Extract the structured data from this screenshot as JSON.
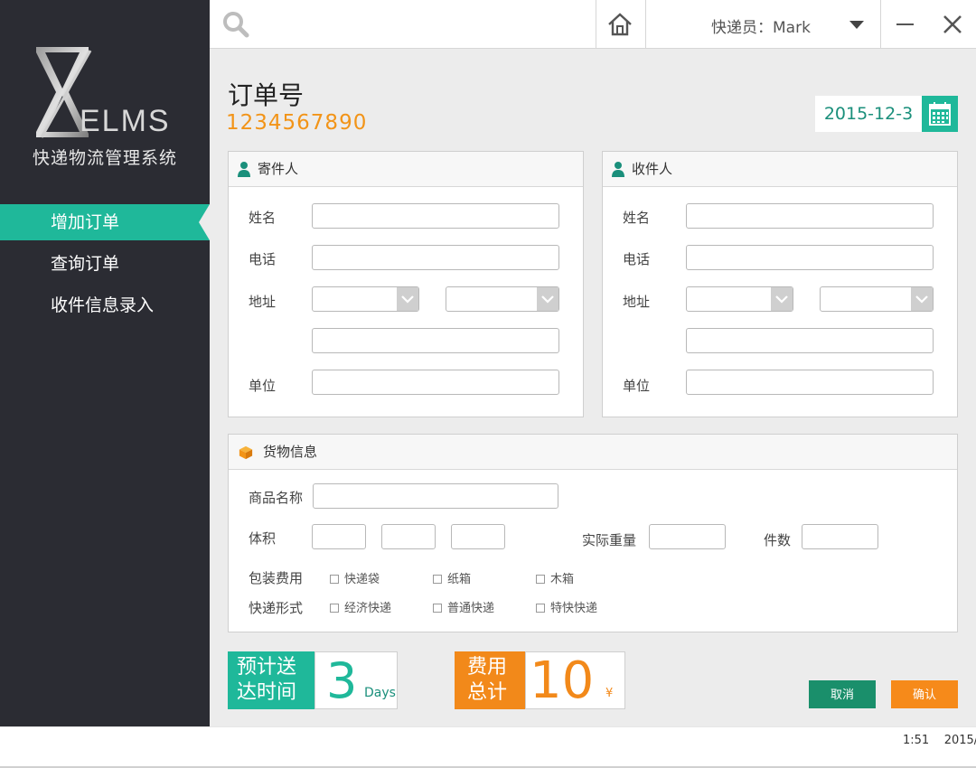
{
  "app": {
    "logo_text": "ELMS",
    "logo_subtitle": "快递物流管理系统"
  },
  "sidebar": {
    "items": [
      {
        "label": "增加订单",
        "active": true
      },
      {
        "label": "查询订单",
        "active": false
      },
      {
        "label": "收件信息录入",
        "active": false
      }
    ]
  },
  "topbar": {
    "courier_label": "快递员：Mark",
    "icons": [
      "search-icon",
      "home-icon",
      "chevron-down-icon",
      "minimize-icon",
      "close-icon"
    ]
  },
  "order": {
    "title": "订单号",
    "number": "1234567890",
    "date": "2015-12-3"
  },
  "sender": {
    "title": "寄件人",
    "name_label": "姓名",
    "phone_label": "电话",
    "address_label": "地址",
    "company_label": "单位"
  },
  "receiver": {
    "title": "收件人",
    "name_label": "姓名",
    "phone_label": "电话",
    "address_label": "地址",
    "company_label": "单位"
  },
  "goods": {
    "title": "货物信息",
    "product_label": "商品名称",
    "volume_label": "体积",
    "weight_label": "实际重量",
    "count_label": "件数",
    "packaging_label": "包装费用",
    "packaging_options": [
      "快递袋",
      "纸箱",
      "木箱"
    ],
    "delivery_label": "快递形式",
    "delivery_options": [
      "经济快递",
      "普通快递",
      "特快快递"
    ]
  },
  "summary": {
    "estimate_label_1": "预计送",
    "estimate_label_2": "达时间",
    "estimate_value": "3",
    "estimate_unit": "Days",
    "fee_label_1": "费用",
    "fee_label_2": "总计",
    "fee_value": "10",
    "fee_unit": "¥"
  },
  "actions": {
    "cancel_label": "取消",
    "confirm_label": "确认"
  },
  "taskbar": {
    "clock": "1:51    2015/"
  },
  "colors": {
    "sidebar_bg": "#2b2c33",
    "accent_green": "#1fb89a",
    "accent_orange": "#f2891a"
  }
}
